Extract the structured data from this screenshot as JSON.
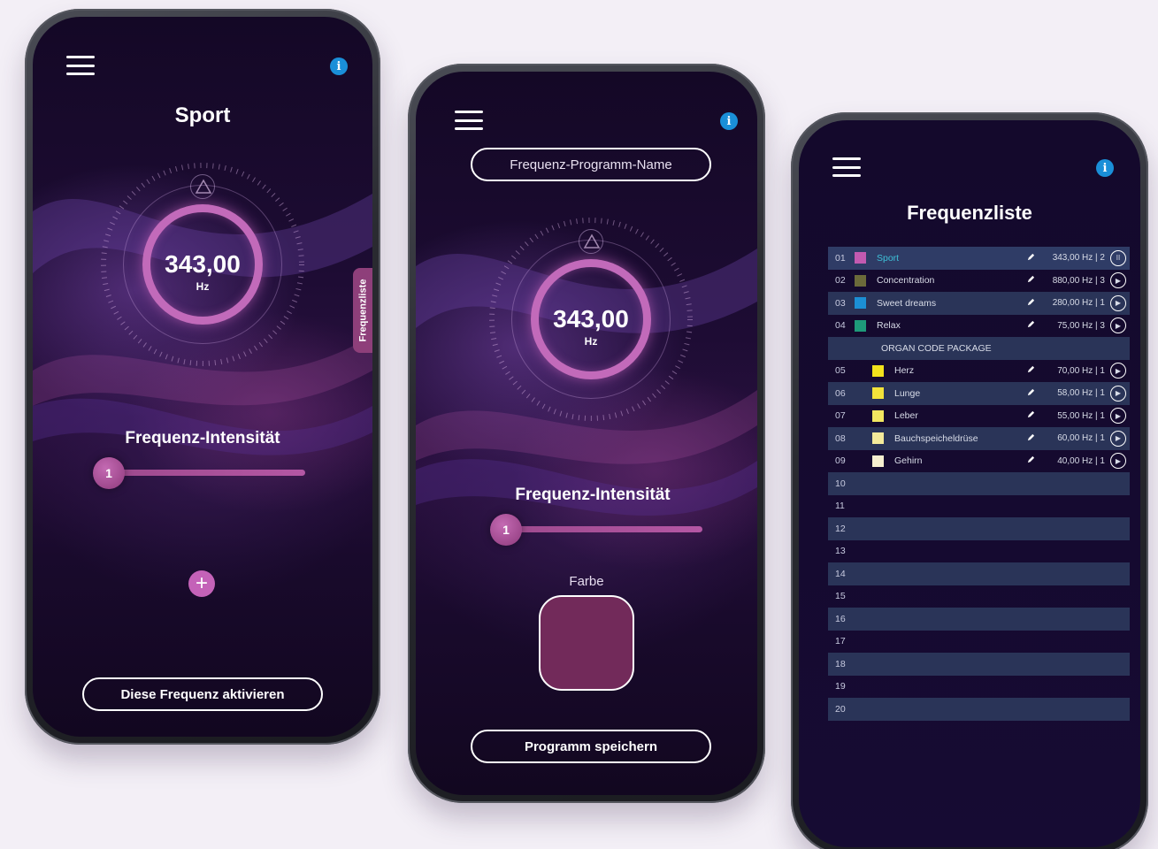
{
  "screen1": {
    "title": "Sport",
    "dial_value": "343,00",
    "dial_unit": "Hz",
    "side_tab": "Frequenzliste",
    "intensity_label": "Frequenz-Intensität",
    "slider_value": "1",
    "slider_level": 0.0,
    "plus": "+",
    "activate_button": "Diese Frequenz aktivieren"
  },
  "screen2": {
    "name_placeholder": "Frequenz-Programm-Name",
    "dial_value": "343,00",
    "dial_unit": "Hz",
    "intensity_label": "Frequenz-Intensität",
    "slider_value": "1",
    "slider_level": 0.0,
    "color_label": "Farbe",
    "color_value": "#722a5a",
    "save_button": "Programm speichern"
  },
  "screen3": {
    "title": "Frequenzliste",
    "rows": [
      {
        "num": "01",
        "color": "#c35ab0",
        "name": "Sport",
        "hz": "343,00 Hz | 2",
        "state": "pause",
        "active": true
      },
      {
        "num": "02",
        "color": "#6b6a3a",
        "name": "Concentration",
        "hz": "880,00 Hz | 3",
        "state": "play"
      },
      {
        "num": "03",
        "color": "#1c8fd4",
        "name": "Sweet dreams",
        "hz": "280,00 Hz | 1",
        "state": "play"
      },
      {
        "num": "04",
        "color": "#1e9a7a",
        "name": "Relax",
        "hz": "75,00 Hz | 3",
        "state": "play"
      },
      {
        "group": "ORGAN CODE PACKAGE"
      },
      {
        "num": "05",
        "color": "#f2e21c",
        "name": "Herz",
        "hz": "70,00 Hz | 1",
        "state": "play",
        "indent": true
      },
      {
        "num": "06",
        "color": "#f2e23a",
        "name": "Lunge",
        "hz": "58,00 Hz | 1",
        "state": "play",
        "indent": true
      },
      {
        "num": "07",
        "color": "#f2e660",
        "name": "Leber",
        "hz": "55,00 Hz | 1",
        "state": "play",
        "indent": true
      },
      {
        "num": "08",
        "color": "#f4ea9a",
        "name": "Bauchspeicheldrüse",
        "hz": "60,00 Hz | 1",
        "state": "play",
        "indent": true
      },
      {
        "num": "09",
        "color": "#f6efcf",
        "name": "Gehirn",
        "hz": "40,00 Hz | 1",
        "state": "play",
        "indent": true
      },
      {
        "num": "10"
      },
      {
        "num": "11"
      },
      {
        "num": "12"
      },
      {
        "num": "13"
      },
      {
        "num": "14"
      },
      {
        "num": "15"
      },
      {
        "num": "16"
      },
      {
        "num": "17"
      },
      {
        "num": "18"
      },
      {
        "num": "19"
      },
      {
        "num": "20"
      }
    ]
  },
  "icons": {
    "menu": "menu-icon",
    "info": "i",
    "pen": "pen-icon",
    "play": "▶",
    "pause": "II"
  }
}
